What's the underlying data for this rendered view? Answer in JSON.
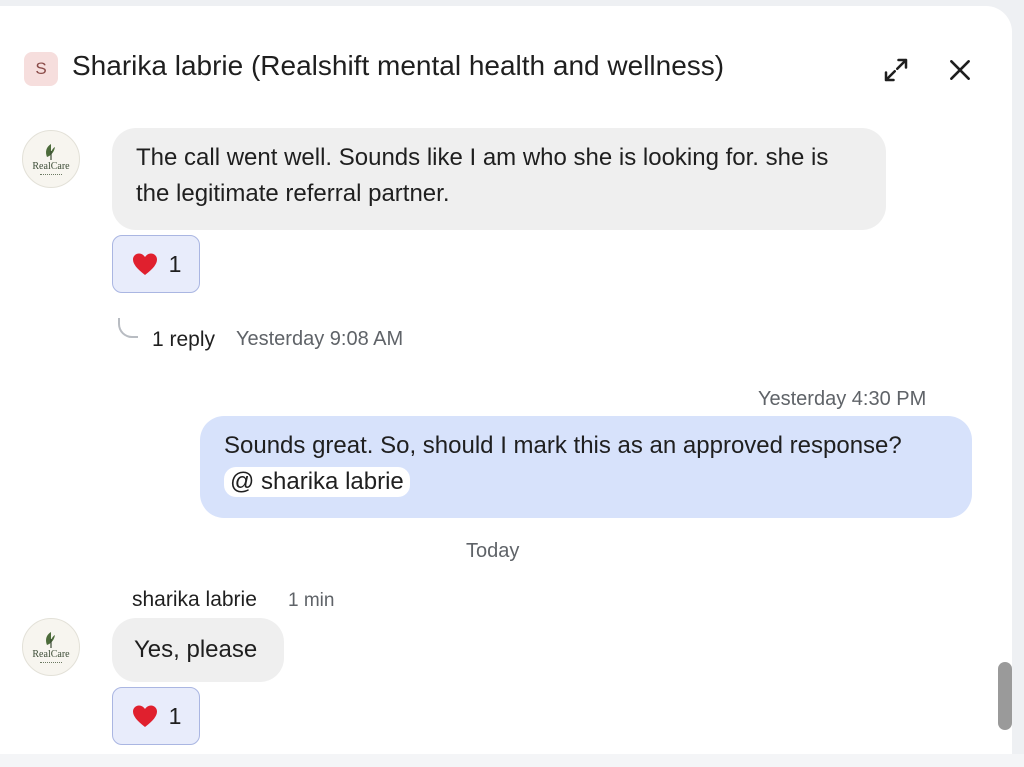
{
  "header": {
    "space_initial": "S",
    "title": "Sharika labrie (Realshift mental health and wellness)",
    "expand_icon": "expand-diagonal-icon",
    "close_icon": "close-icon"
  },
  "avatar": {
    "brand_text": "RealCare"
  },
  "messages": [
    {
      "text": "The call went well. Sounds like I am who she is looking for. she is the legitimate referral partner.",
      "reaction": {
        "emoji": "red-heart-icon",
        "count": "1"
      },
      "thread": {
        "replies": "1 reply",
        "time": "Yesterday 9:08 AM"
      }
    },
    {
      "time": "Yesterday 4:30 PM",
      "text": "Sounds great. So, should I mark this as an approved response?",
      "mention": "@ sharika labrie"
    },
    {
      "sender": "sharika labrie",
      "sender_time": "1 min",
      "text": "Yes, please",
      "reaction": {
        "emoji": "red-heart-icon",
        "count": "1"
      }
    }
  ],
  "date_divider": "Today",
  "colors": {
    "incoming_bubble": "#efefef",
    "outgoing_bubble": "#d7e2fb",
    "reaction_bg": "#e8ecfb",
    "reaction_border": "#aab6e2",
    "heart": "#e0202e"
  }
}
